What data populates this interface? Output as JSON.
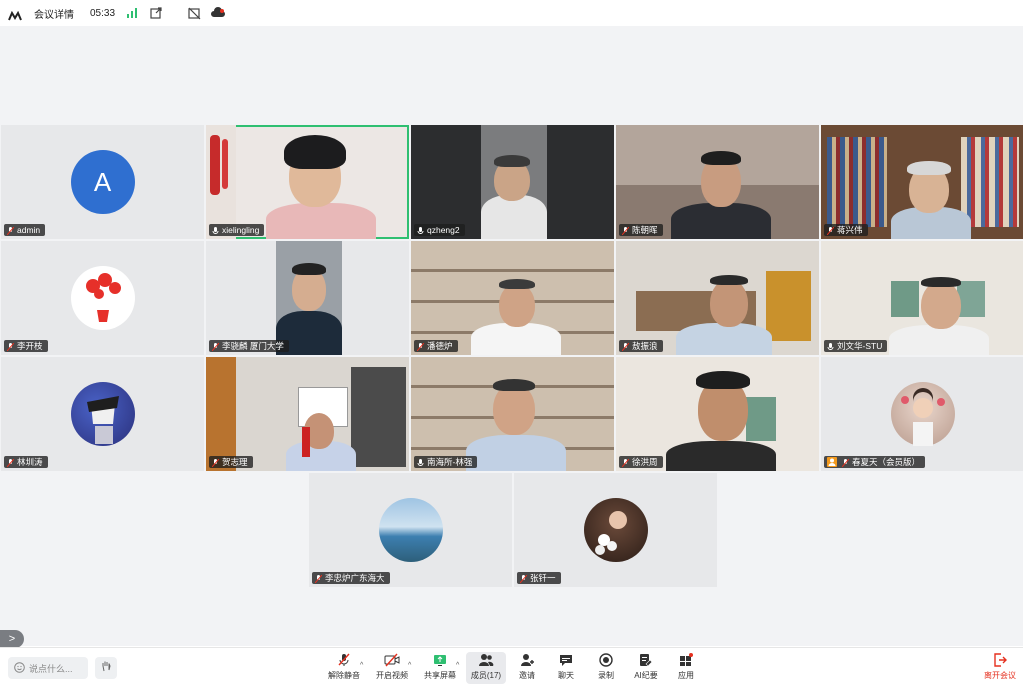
{
  "topbar": {
    "title": "会议详情",
    "time": "05:33",
    "icons": [
      "meeting-logo-icon",
      "signal-icon",
      "share-out-icon",
      "no-record-icon",
      "cloud-icon"
    ]
  },
  "participants": [
    {
      "name": "admin",
      "type": "letter",
      "letter": "A",
      "color": "#2f6fd0"
    },
    {
      "name": "xielingling",
      "type": "video",
      "active": true
    },
    {
      "name": "qzheng2",
      "type": "video"
    },
    {
      "name": "陈朝晖",
      "type": "video"
    },
    {
      "name": "蒋兴伟",
      "type": "video"
    },
    {
      "name": "李开枝",
      "type": "image"
    },
    {
      "name": "李骁麟 厦门大学",
      "type": "video"
    },
    {
      "name": "潘德炉",
      "type": "video"
    },
    {
      "name": "敖振浪",
      "type": "video"
    },
    {
      "name": "刘文华-STU",
      "type": "video"
    },
    {
      "name": "林圳涛",
      "type": "image"
    },
    {
      "name": "贺志理",
      "type": "video"
    },
    {
      "name": "南海所-林强",
      "type": "video"
    },
    {
      "name": "徐洪周",
      "type": "video"
    },
    {
      "name": "春夏天（会员版）",
      "type": "image",
      "host": true
    },
    {
      "name": "李忠炉广东海大",
      "type": "image"
    },
    {
      "name": "张钎一",
      "type": "image"
    }
  ],
  "collapse": ">",
  "toolbar": {
    "chat_placeholder": "说点什么...",
    "items": [
      {
        "label": "解除静音",
        "icon": "mic-muted-icon"
      },
      {
        "label": "开启视频",
        "icon": "camera-off-icon"
      },
      {
        "label": "共享屏幕",
        "icon": "share-screen-icon"
      },
      {
        "label": "成员(17)",
        "icon": "members-icon"
      },
      {
        "label": "邀请",
        "icon": "invite-icon"
      },
      {
        "label": "聊天",
        "icon": "chat-icon"
      },
      {
        "label": "录制",
        "icon": "record-icon"
      },
      {
        "label": "AI纪要",
        "icon": "ai-notes-icon"
      },
      {
        "label": "应用",
        "icon": "apps-icon"
      }
    ],
    "leave_label": "离开会议"
  },
  "colors": {
    "accent": "#2fbf71",
    "leave": "#e5301f",
    "host_badge": "#f39a1e"
  }
}
